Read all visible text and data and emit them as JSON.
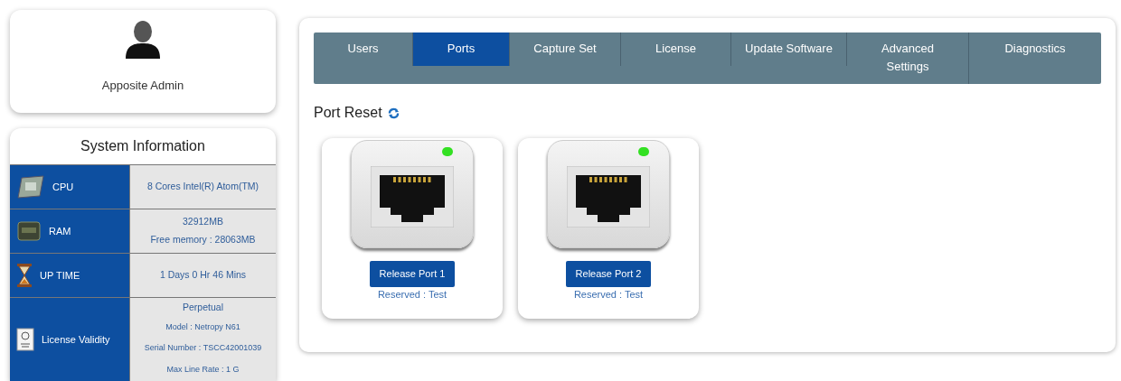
{
  "profile": {
    "name": "Apposite Admin"
  },
  "system_information": {
    "title": "System Information",
    "rows": [
      {
        "kind": "cpu",
        "label": "CPU",
        "lines": [
          "8 Cores Intel(R) Atom(TM)"
        ]
      },
      {
        "kind": "ram",
        "label": "RAM",
        "lines": [
          "32912MB",
          "Free memory : 28063MB"
        ]
      },
      {
        "kind": "uptime",
        "label": "UP TIME",
        "lines": [
          "1 Days 0 Hr 46 Mins"
        ]
      },
      {
        "kind": "license",
        "label": "License Validity",
        "lines": [
          "Perpetual",
          "Model : Netropy N61",
          "Serial Number : TSCC42001039",
          "Max Line Rate : 1 G"
        ]
      }
    ]
  },
  "tabs": [
    {
      "label": "Users",
      "selected": false
    },
    {
      "label": "Ports",
      "selected": true
    },
    {
      "label": "Capture Set",
      "selected": false
    },
    {
      "label": "License",
      "selected": false
    },
    {
      "label": "Update Software",
      "selected": false
    },
    {
      "label": "Advanced Settings",
      "selected": false
    },
    {
      "label": "Diagnostics",
      "selected": false
    }
  ],
  "section_title": "Port Reset",
  "ports": [
    {
      "button": "Release Port 1",
      "status": "Reserved : Test",
      "link_up": true
    },
    {
      "button": "Release Port 2",
      "status": "Reserved : Test",
      "link_up": true
    }
  ]
}
